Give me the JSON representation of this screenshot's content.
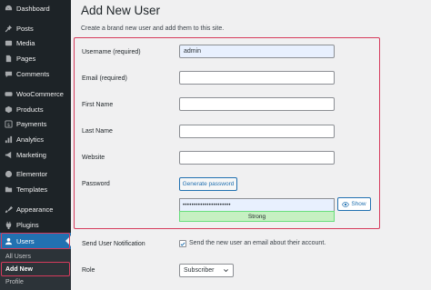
{
  "sidebar": {
    "items": [
      {
        "label": "Dashboard",
        "icon": "dashboard-icon"
      },
      {
        "label": "Posts",
        "icon": "pin-icon"
      },
      {
        "label": "Media",
        "icon": "media-icon"
      },
      {
        "label": "Pages",
        "icon": "page-icon"
      },
      {
        "label": "Comments",
        "icon": "comment-icon"
      },
      {
        "label": "WooCommerce",
        "icon": "woo-icon"
      },
      {
        "label": "Products",
        "icon": "box-icon"
      },
      {
        "label": "Payments",
        "icon": "dollar-icon"
      },
      {
        "label": "Analytics",
        "icon": "bar-chart-icon"
      },
      {
        "label": "Marketing",
        "icon": "megaphone-icon"
      },
      {
        "label": "Elementor",
        "icon": "elementor-icon"
      },
      {
        "label": "Templates",
        "icon": "folder-icon"
      },
      {
        "label": "Appearance",
        "icon": "brush-icon"
      },
      {
        "label": "Plugins",
        "icon": "plug-icon"
      },
      {
        "label": "Users",
        "icon": "users-icon"
      }
    ],
    "submenu": [
      {
        "label": "All Users"
      },
      {
        "label": "Add New"
      },
      {
        "label": "Profile"
      }
    ],
    "active_color": "#2271b1",
    "highlight_color": "#d63b5c"
  },
  "page": {
    "title": "Add New User",
    "description": "Create a brand new user and add them to this site."
  },
  "form": {
    "username_label": "Username (required)",
    "username_value": "admin",
    "email_label": "Email (required)",
    "email_value": "",
    "first_name_label": "First Name",
    "first_name_value": "",
    "last_name_label": "Last Name",
    "last_name_value": "",
    "website_label": "Website",
    "website_value": "",
    "password_label": "Password",
    "generate_password_label": "Generate password",
    "password_value": "••••••••••••••••••••••",
    "password_strength": "Strong",
    "show_label": "Show",
    "notification_label": "Send User Notification",
    "notification_text": "Send the new user an email about their account.",
    "notification_checked": true,
    "role_label": "Role",
    "role_value": "Subscriber"
  }
}
